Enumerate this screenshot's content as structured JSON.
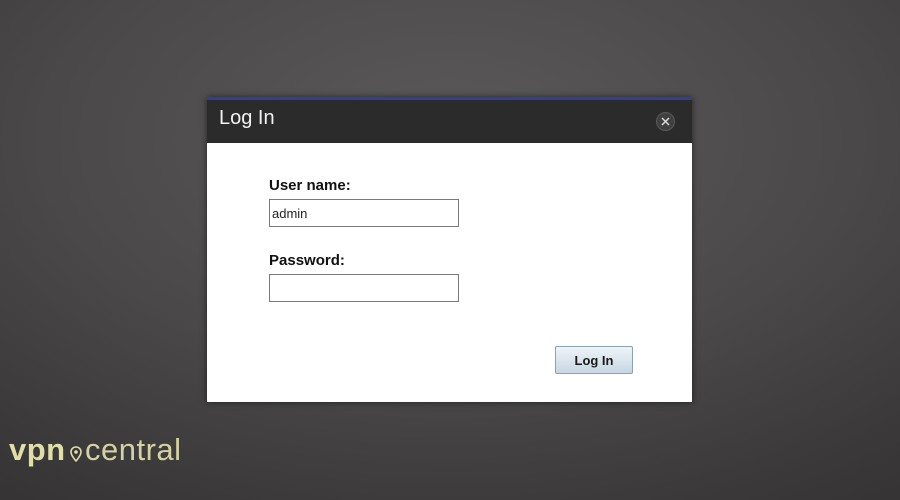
{
  "dialog": {
    "title": "Log In",
    "close_icon": "close-icon"
  },
  "form": {
    "username_label": "User name:",
    "username_value": "admin",
    "password_label": "Password:",
    "password_value": "",
    "submit_label": "Log In"
  },
  "watermark": {
    "brand_part1": "vpn",
    "brand_part2": "central"
  },
  "colors": {
    "header_bg": "#2b2b2b",
    "header_accent": "#2f3f9e",
    "button_bg": "#c7d7e3",
    "watermark": "#e1dfa8"
  }
}
